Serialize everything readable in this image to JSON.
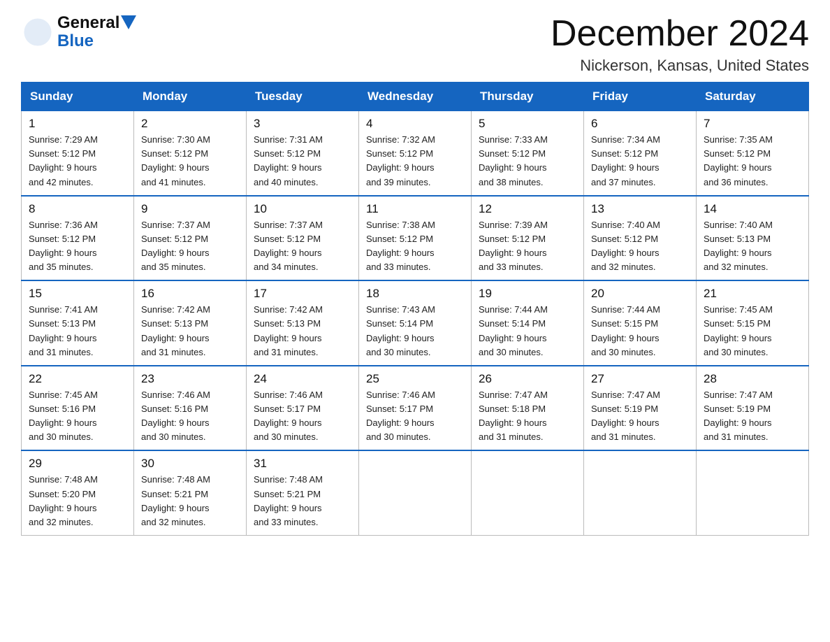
{
  "logo": {
    "general": "General",
    "blue": "Blue"
  },
  "title": {
    "month_year": "December 2024",
    "location": "Nickerson, Kansas, United States"
  },
  "weekdays": [
    "Sunday",
    "Monday",
    "Tuesday",
    "Wednesday",
    "Thursday",
    "Friday",
    "Saturday"
  ],
  "weeks": [
    [
      {
        "day": "1",
        "sunrise": "7:29 AM",
        "sunset": "5:12 PM",
        "daylight": "9 hours and 42 minutes."
      },
      {
        "day": "2",
        "sunrise": "7:30 AM",
        "sunset": "5:12 PM",
        "daylight": "9 hours and 41 minutes."
      },
      {
        "day": "3",
        "sunrise": "7:31 AM",
        "sunset": "5:12 PM",
        "daylight": "9 hours and 40 minutes."
      },
      {
        "day": "4",
        "sunrise": "7:32 AM",
        "sunset": "5:12 PM",
        "daylight": "9 hours and 39 minutes."
      },
      {
        "day": "5",
        "sunrise": "7:33 AM",
        "sunset": "5:12 PM",
        "daylight": "9 hours and 38 minutes."
      },
      {
        "day": "6",
        "sunrise": "7:34 AM",
        "sunset": "5:12 PM",
        "daylight": "9 hours and 37 minutes."
      },
      {
        "day": "7",
        "sunrise": "7:35 AM",
        "sunset": "5:12 PM",
        "daylight": "9 hours and 36 minutes."
      }
    ],
    [
      {
        "day": "8",
        "sunrise": "7:36 AM",
        "sunset": "5:12 PM",
        "daylight": "9 hours and 35 minutes."
      },
      {
        "day": "9",
        "sunrise": "7:37 AM",
        "sunset": "5:12 PM",
        "daylight": "9 hours and 35 minutes."
      },
      {
        "day": "10",
        "sunrise": "7:37 AM",
        "sunset": "5:12 PM",
        "daylight": "9 hours and 34 minutes."
      },
      {
        "day": "11",
        "sunrise": "7:38 AM",
        "sunset": "5:12 PM",
        "daylight": "9 hours and 33 minutes."
      },
      {
        "day": "12",
        "sunrise": "7:39 AM",
        "sunset": "5:12 PM",
        "daylight": "9 hours and 33 minutes."
      },
      {
        "day": "13",
        "sunrise": "7:40 AM",
        "sunset": "5:12 PM",
        "daylight": "9 hours and 32 minutes."
      },
      {
        "day": "14",
        "sunrise": "7:40 AM",
        "sunset": "5:13 PM",
        "daylight": "9 hours and 32 minutes."
      }
    ],
    [
      {
        "day": "15",
        "sunrise": "7:41 AM",
        "sunset": "5:13 PM",
        "daylight": "9 hours and 31 minutes."
      },
      {
        "day": "16",
        "sunrise": "7:42 AM",
        "sunset": "5:13 PM",
        "daylight": "9 hours and 31 minutes."
      },
      {
        "day": "17",
        "sunrise": "7:42 AM",
        "sunset": "5:13 PM",
        "daylight": "9 hours and 31 minutes."
      },
      {
        "day": "18",
        "sunrise": "7:43 AM",
        "sunset": "5:14 PM",
        "daylight": "9 hours and 30 minutes."
      },
      {
        "day": "19",
        "sunrise": "7:44 AM",
        "sunset": "5:14 PM",
        "daylight": "9 hours and 30 minutes."
      },
      {
        "day": "20",
        "sunrise": "7:44 AM",
        "sunset": "5:15 PM",
        "daylight": "9 hours and 30 minutes."
      },
      {
        "day": "21",
        "sunrise": "7:45 AM",
        "sunset": "5:15 PM",
        "daylight": "9 hours and 30 minutes."
      }
    ],
    [
      {
        "day": "22",
        "sunrise": "7:45 AM",
        "sunset": "5:16 PM",
        "daylight": "9 hours and 30 minutes."
      },
      {
        "day": "23",
        "sunrise": "7:46 AM",
        "sunset": "5:16 PM",
        "daylight": "9 hours and 30 minutes."
      },
      {
        "day": "24",
        "sunrise": "7:46 AM",
        "sunset": "5:17 PM",
        "daylight": "9 hours and 30 minutes."
      },
      {
        "day": "25",
        "sunrise": "7:46 AM",
        "sunset": "5:17 PM",
        "daylight": "9 hours and 30 minutes."
      },
      {
        "day": "26",
        "sunrise": "7:47 AM",
        "sunset": "5:18 PM",
        "daylight": "9 hours and 31 minutes."
      },
      {
        "day": "27",
        "sunrise": "7:47 AM",
        "sunset": "5:19 PM",
        "daylight": "9 hours and 31 minutes."
      },
      {
        "day": "28",
        "sunrise": "7:47 AM",
        "sunset": "5:19 PM",
        "daylight": "9 hours and 31 minutes."
      }
    ],
    [
      {
        "day": "29",
        "sunrise": "7:48 AM",
        "sunset": "5:20 PM",
        "daylight": "9 hours and 32 minutes."
      },
      {
        "day": "30",
        "sunrise": "7:48 AM",
        "sunset": "5:21 PM",
        "daylight": "9 hours and 32 minutes."
      },
      {
        "day": "31",
        "sunrise": "7:48 AM",
        "sunset": "5:21 PM",
        "daylight": "9 hours and 33 minutes."
      },
      null,
      null,
      null,
      null
    ]
  ],
  "labels": {
    "sunrise": "Sunrise:",
    "sunset": "Sunset:",
    "daylight": "Daylight:"
  },
  "colors": {
    "header_bg": "#1565c0",
    "header_text": "#ffffff",
    "border": "#bbbbbb"
  }
}
